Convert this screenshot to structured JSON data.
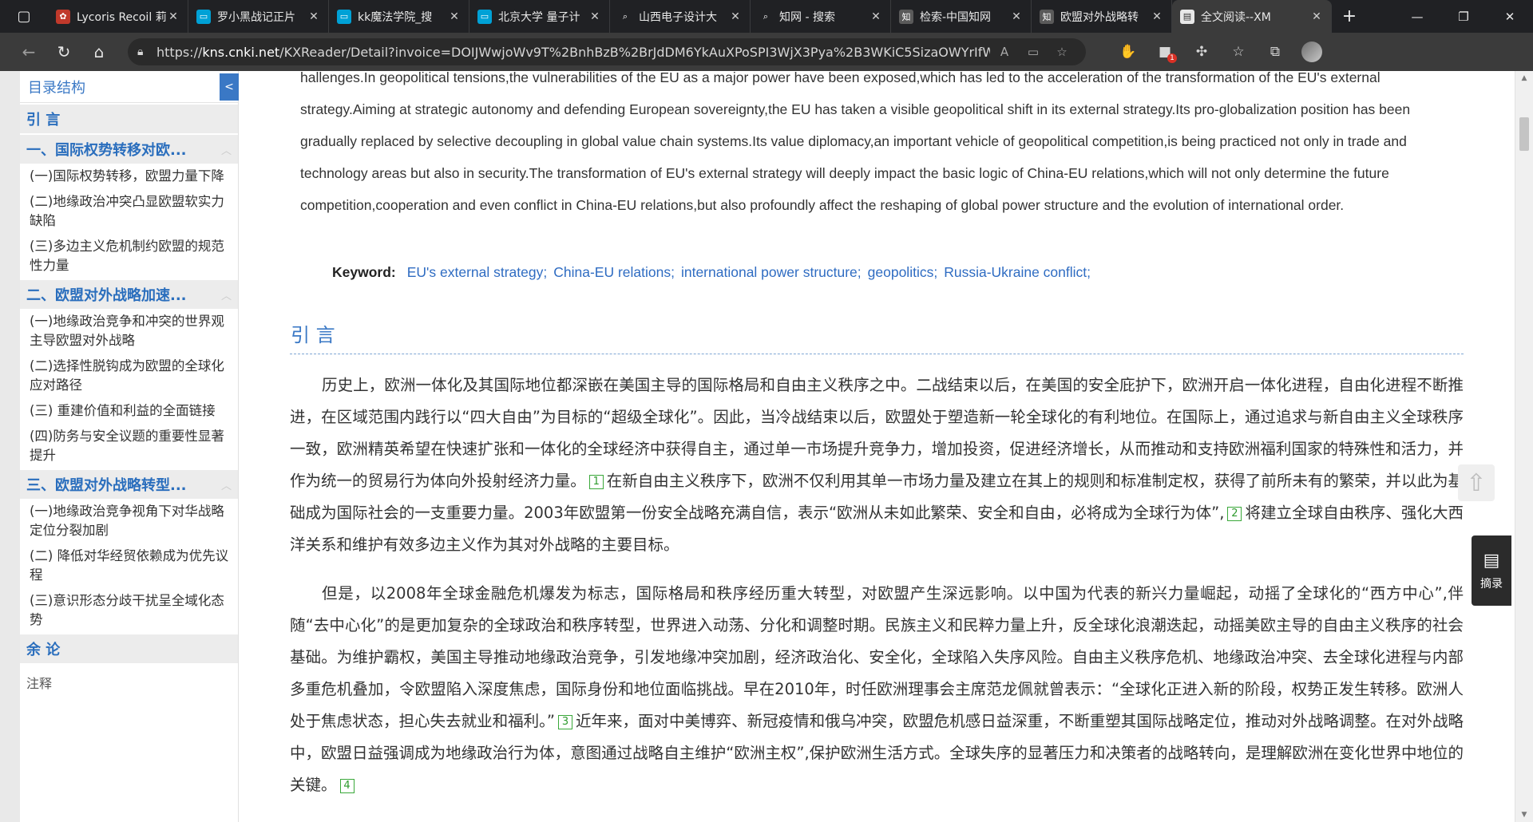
{
  "browser": {
    "tabs": [
      {
        "label": "Lycoris Recoil 莉",
        "fav_color": "#c0392b",
        "fav_glyph": "✿"
      },
      {
        "label": "罗小黑战记正片",
        "fav_color": "#00a1d6",
        "fav_glyph": "▭"
      },
      {
        "label": "kk魔法学院_搜",
        "fav_color": "#00a1d6",
        "fav_glyph": "▭"
      },
      {
        "label": "北京大学 量子计",
        "fav_color": "#00a1d6",
        "fav_glyph": "▭"
      },
      {
        "label": "山西电子设计大",
        "fav_color": "#202124",
        "fav_glyph": "⌕"
      },
      {
        "label": "知网 - 搜索",
        "fav_color": "#202124",
        "fav_glyph": "⌕"
      },
      {
        "label": "检索-中国知网",
        "fav_color": "#5a5a5a",
        "fav_glyph": "知"
      },
      {
        "label": "欧盟对外战略转",
        "fav_color": "#5a5a5a",
        "fav_glyph": "知"
      },
      {
        "label": "全文阅读--XM",
        "fav_color": "#e8e8e8",
        "fav_glyph": "▤",
        "active": true
      }
    ],
    "url_prefix": "https://",
    "url_host": "kns.cnki.net",
    "url_path": "/KXReader/Detail?invoice=DOIJWwjoWv9T%2BnhBzB%2BrJdDM6YkAuXPoSPI3WjX3Pya%2B3WKiC5SizaOWYrIfWdeiWnJPy%...",
    "extension_badge": "1"
  },
  "sidebar": {
    "title": "目录结构",
    "toggle": "<",
    "sections": [
      {
        "title": "引 言",
        "items": []
      },
      {
        "title": "一、国际权势转移对欧...",
        "items": [
          "(一)国际权势转移，欧盟力量下降",
          "(二)地缘政治冲突凸显欧盟软实力缺陷",
          "(三)多边主义危机制约欧盟的规范性力量"
        ]
      },
      {
        "title": "二、欧盟对外战略加速...",
        "items": [
          "(一)地缘政治竞争和冲突的世界观主导欧盟对外战略",
          "(二)选择性脱钩成为欧盟的全球化应对路径",
          "(三) 重建价值和利益的全面链接",
          "(四)防务与安全议题的重要性显著提升"
        ]
      },
      {
        "title": "三、欧盟对外战略转型...",
        "items": [
          "(一)地缘政治竞争视角下对华战略定位分裂加剧",
          "(二) 降低对华经贸依赖成为优先议程",
          "(三)意识形态分歧干扰呈全域化态势"
        ]
      },
      {
        "title": "余 论",
        "items": []
      }
    ],
    "notes": "注释"
  },
  "article": {
    "en_abstract": "hallenges.In geopolitical tensions,the vulnerabilities of the EU as a major power have been exposed,which has led to the acceleration of the transformation of the EU's external strategy.Aiming at strategic autonomy and defending European sovereignty,the EU has taken a visible geopolitical shift in its external strategy.Its pro-globalization position has been gradually replaced by selective decoupling in global value chain systems.Its value diplomacy,an important vehicle of geopolitical competition,is being practiced not only in trade and technology areas but also in security.The transformation of EU's external strategy will deeply impact the basic logic of China-EU relations,which will not only determine the future competition,cooperation and even conflict in China-EU relations,but also profoundly affect the reshaping of global power structure and the evolution of international order.",
    "keyword_label": "Keyword:",
    "keywords": [
      "EU's external strategy;",
      "China-EU relations;",
      "international power structure;",
      "geopolitics;",
      "Russia-Ukraine conflict;"
    ],
    "section_title": "引 言",
    "p1_a": "历史上，欧洲一体化及其国际地位都深嵌在美国主导的国际格局和自由主义秩序之中。二战结束以后，在美国的安全庇护下，欧洲开启一体化进程，自由化进程不断推进，在区域范围内践行以“四大自由”为目标的“超级全球化”。因此，当冷战结束以后，欧盟处于塑造新一轮全球化的有利地位。在国际上，通过追求与新自由主义全球秩序一致，欧洲精英希望在快速扩张和一体化的全球经济中获得自主，通过单一市场提升竞争力，增加投资，促进经济增长，从而推动和支持欧洲福利国家的特殊性和活力，并作为统一的贸易行为体向外投射经济力量。",
    "ref1": "1",
    "p1_b": "在新自由主义秩序下，欧洲不仅利用其单一市场力量及建立在其上的规则和标准制定权，获得了前所未有的繁荣，并以此为基础成为国际社会的一支重要力量。2003年欧盟第一份安全战略充满自信，表示“欧洲从未如此繁荣、安全和自由，必将成为全球行为体”,",
    "ref2": "2",
    "p1_c": "将建立全球自由秩序、强化大西洋关系和维护有效多边主义作为其对外战略的主要目标。",
    "p2_a": "但是，以2008年全球金融危机爆发为标志，国际格局和秩序经历重大转型，对欧盟产生深远影响。以中国为代表的新兴力量崛起，动摇了全球化的“西方中心”,伴随“去中心化”的是更加复杂的全球政治和秩序转型，世界进入动荡、分化和调整时期。民族主义和民粹力量上升，反全球化浪潮迭起，动摇美欧主导的自由主义秩序的社会基础。为维护霸权，美国主导推动地缘政治竞争，引发地缘冲突加剧，经济政治化、安全化，全球陷入失序风险。自由主义秩序危机、地缘政治冲突、去全球化进程与内部多重危机叠加，令欧盟陷入深度焦虑，国际身份和地位面临挑战。早在2010年，时任欧洲理事会主席范龙佩就曾表示：“全球化正进入新的阶段，权势正发生转移。欧洲人处于焦虑状态，担心失去就业和福利。”",
    "ref3": "3",
    "p2_b": "近年来，面对中美博弈、新冠疫情和俄乌冲突，欧盟危机感日益深重，不断重塑其国际战略定位，推动对外战略调整。在对外战略中，欧盟日益强调成为地缘政治行为体，意图通过战略自主维护“欧洲主权”,保护欧洲生活方式。全球失序的显著压力和决策者的战略转向，是理解欧洲在变化世界中地位的关键。",
    "ref4": "4"
  },
  "widgets": {
    "totop": "⇧",
    "abstract_label": "摘录"
  }
}
